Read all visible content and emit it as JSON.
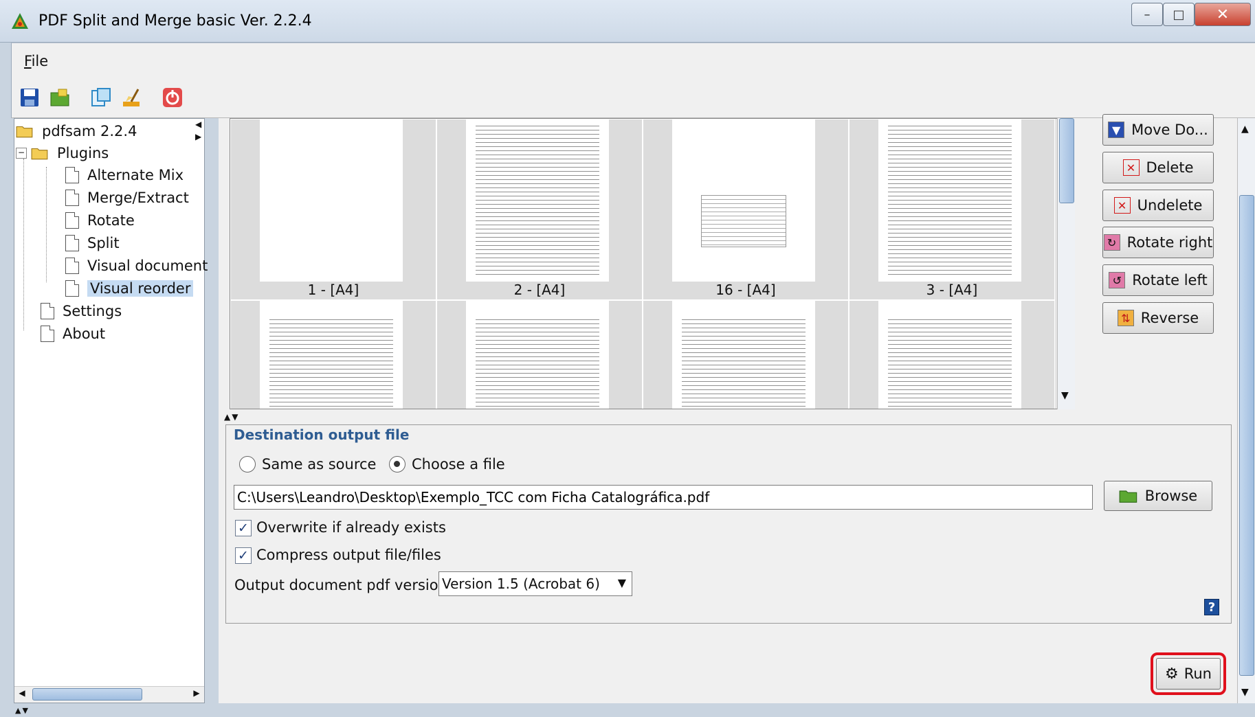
{
  "window": {
    "title": "PDF Split and Merge basic Ver. 2.2.4",
    "controls": {
      "minimize": "–",
      "maximize": "□",
      "close": "✕"
    }
  },
  "menu": {
    "file_mnemonic": "F",
    "file_rest": "ile"
  },
  "toolbar": {
    "icons": [
      "save-icon",
      "load-icon",
      "environment-icon",
      "clear-icon",
      "exit-icon"
    ]
  },
  "tree": {
    "root": "pdfsam 2.2.4",
    "plugins": "Plugins",
    "items": [
      "Alternate Mix",
      "Merge/Extract",
      "Rotate",
      "Split",
      "Visual document",
      "Visual reorder"
    ],
    "selected": "Visual reorder",
    "settings": "Settings",
    "about": "About"
  },
  "thumbnails": {
    "labels": [
      "1 - [A4]",
      "2 - [A4]",
      "16 - [A4]",
      "3 - [A4]"
    ]
  },
  "side_buttons": {
    "move_down": "Move Do...",
    "delete": "Delete",
    "undelete": "Undelete",
    "rotate_right": "Rotate right",
    "rotate_left": "Rotate left",
    "reverse": "Reverse"
  },
  "destination": {
    "legend": "Destination output file",
    "same_as_source": "Same as source",
    "choose_file": "Choose a file",
    "selected_option": "Choose a file",
    "path": "C:\\Users\\Leandro\\Desktop\\Exemplo_TCC com Ficha Catalográfica.pdf",
    "browse": "Browse",
    "overwrite": "Overwrite if already exists",
    "overwrite_checked": true,
    "compress": "Compress output file/files",
    "compress_checked": true,
    "version_label": "Output document pdf version:",
    "version_value": "Version 1.5 (Acrobat 6)",
    "help": "?"
  },
  "run": {
    "label": "Run"
  },
  "colors": {
    "highlight": "#e0101c",
    "legend": "#2e5c92",
    "selection": "#c5dbf2"
  }
}
